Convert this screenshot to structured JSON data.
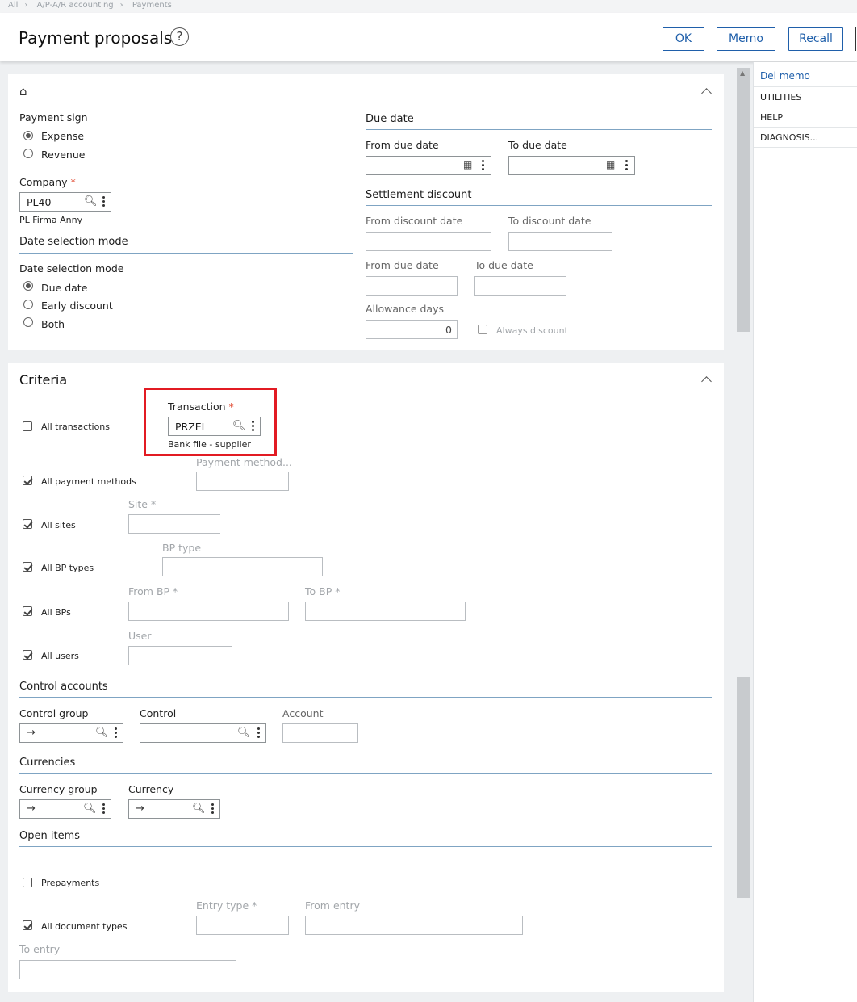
{
  "breadcrumb": [
    "All",
    "A/P-A/R accounting",
    "Payments"
  ],
  "header": {
    "title": "Payment proposals",
    "help_glyph": "?",
    "buttons": {
      "ok": "OK",
      "memo": "Memo",
      "recall": "Recall"
    }
  },
  "right_panel": {
    "items": [
      "Del memo",
      "UTILITIES",
      "HELP",
      "DIAGNOSIS..."
    ]
  },
  "general": {
    "payment_sign_label": "Payment sign",
    "payment_sign_options": [
      "Expense",
      "Revenue"
    ],
    "payment_sign_selected": "Expense",
    "company_label": "Company",
    "company_value": "PL40",
    "company_name": "PL Firma Anny",
    "date_selection_section": "Date selection mode",
    "date_selection_label": "Date selection mode",
    "date_selection_options": [
      "Due date",
      "Early discount",
      "Both"
    ],
    "date_selection_selected": "Due date",
    "due_date_section": "Due date",
    "from_due_date_label": "From due date",
    "to_due_date_label": "To due date",
    "settlement_section": "Settlement discount",
    "from_discount_date_label": "From discount date",
    "to_discount_date_label": "To discount date",
    "from_due_date2_label": "From due date",
    "to_due_date2_label": "To due date",
    "allowance_days_label": "Allowance days",
    "allowance_days_value": "0",
    "always_discount_label": "Always discount"
  },
  "criteria": {
    "title": "Criteria",
    "all_transactions_label": "All transactions",
    "transaction_label": "Transaction",
    "transaction_value": "PRZEL",
    "transaction_desc": "Bank file - supplier",
    "all_payment_methods_label": "All payment methods",
    "payment_method_label": "Payment method...",
    "all_sites_label": "All sites",
    "site_label": "Site",
    "all_bp_types_label": "All BP types",
    "bp_type_label": "BP type",
    "all_bps_label": "All BPs",
    "from_bp_label": "From BP",
    "to_bp_label": "To BP",
    "all_users_label": "All users",
    "user_label": "User",
    "control_accounts_section": "Control accounts",
    "control_group_label": "Control group",
    "control_label": "Control",
    "account_label": "Account",
    "currencies_section": "Currencies",
    "currency_group_label": "Currency group",
    "currency_label": "Currency",
    "open_items_section": "Open items",
    "prepayments_label": "Prepayments",
    "all_document_types_label": "All document types",
    "entry_type_label": "Entry type",
    "from_entry_label": "From entry",
    "to_entry_label": "To entry",
    "arrow_glyph": "→",
    "required_mark": "*",
    "dim_required_mark": "*"
  },
  "checkbox_states": {
    "all_transactions": false,
    "all_payment_methods": true,
    "all_sites": true,
    "all_bp_types": true,
    "all_bps": true,
    "all_users": true,
    "prepayments": false,
    "all_document_types": true,
    "always_discount": false
  },
  "colors": {
    "accent": "#1f5faa",
    "highlight": "#e21b23",
    "required": "#e0452c",
    "section_rule": "#7fa4c3"
  }
}
